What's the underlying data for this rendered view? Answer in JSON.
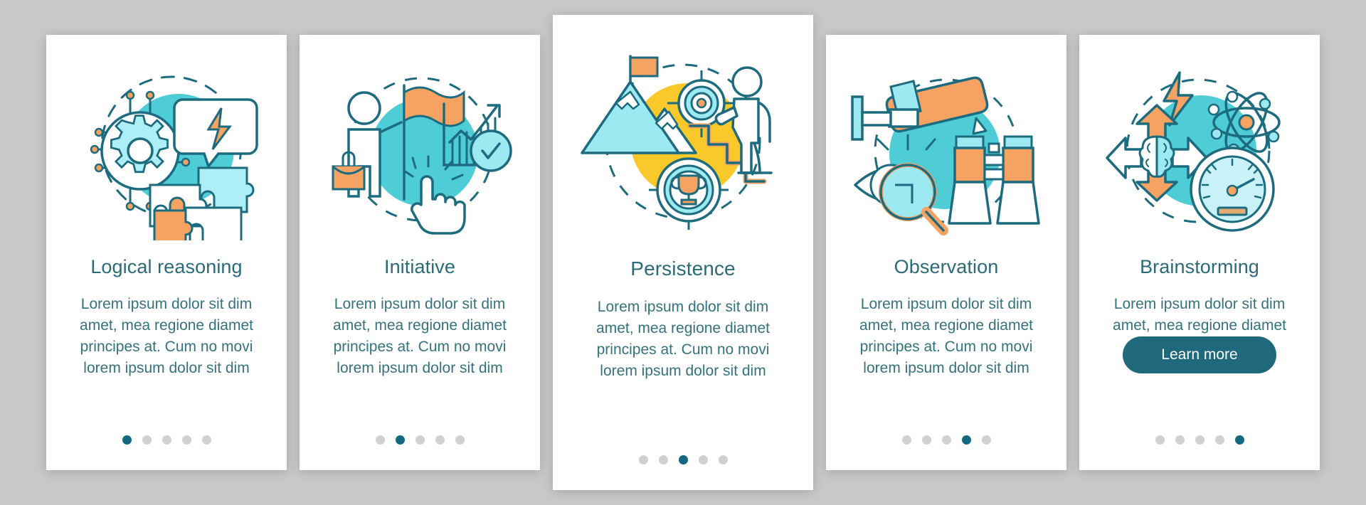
{
  "page": {
    "background_color": "#c8c8c8",
    "card_background": "#ffffff",
    "title_color": "#2b6b78",
    "body_color": "#35737c",
    "accent_teal": "#4ecdd6",
    "accent_orange": "#f5a263",
    "accent_yellow": "#f9c92c",
    "accent_light_cyan": "#aeeef7",
    "stroke_color": "#1c6b7e",
    "dot_active_color": "#12687f",
    "dot_inactive_color": "#d0d0d0",
    "button_color": "#20697d",
    "total_steps": 5
  },
  "cards": [
    {
      "id": "logical-reasoning",
      "title": "Logical reasoning",
      "body": "Lorem ipsum dolor sit dim amet, mea regione diamet principes at. Cum no movi lorem ipsum dolor sit dim",
      "illustration": "gear-puzzle-lightning-icon",
      "illustration_blob_color": "#4ecdd6",
      "active_dot": 1,
      "featured": false,
      "has_button": false,
      "button_label": null
    },
    {
      "id": "initiative",
      "title": "Initiative",
      "body": "Lorem ipsum dolor sit dim amet, mea regione diamet principes at. Cum no movi lorem ipsum dolor sit dim",
      "illustration": "person-flag-chart-icon",
      "illustration_blob_color": "#4ecdd6",
      "active_dot": 2,
      "featured": false,
      "has_button": false,
      "button_label": null
    },
    {
      "id": "persistence",
      "title": "Persistence",
      "body": "Lorem ipsum dolor sit dim amet, mea regione diamet principes at. Cum no movi lorem ipsum dolor sit dim",
      "illustration": "mountain-stairs-trophy-icon",
      "illustration_blob_color": "#f9c92c",
      "active_dot": 3,
      "featured": true,
      "has_button": false,
      "button_label": null
    },
    {
      "id": "observation",
      "title": "Observation",
      "body": "Lorem ipsum dolor sit dim amet, mea regione diamet principes at. Cum no movi lorem ipsum dolor sit dim",
      "illustration": "camera-eye-binoculars-icon",
      "illustration_blob_color": "#4ecdd6",
      "active_dot": 4,
      "featured": false,
      "has_button": false,
      "button_label": null
    },
    {
      "id": "brainstorming",
      "title": "Brainstorming",
      "body": "Lorem ipsum dolor sit dim amet, mea regione diamet",
      "illustration": "brain-atom-gauge-icon",
      "illustration_blob_color": "#4ecdd6",
      "active_dot": 5,
      "featured": false,
      "has_button": true,
      "button_label": "Learn more"
    }
  ]
}
